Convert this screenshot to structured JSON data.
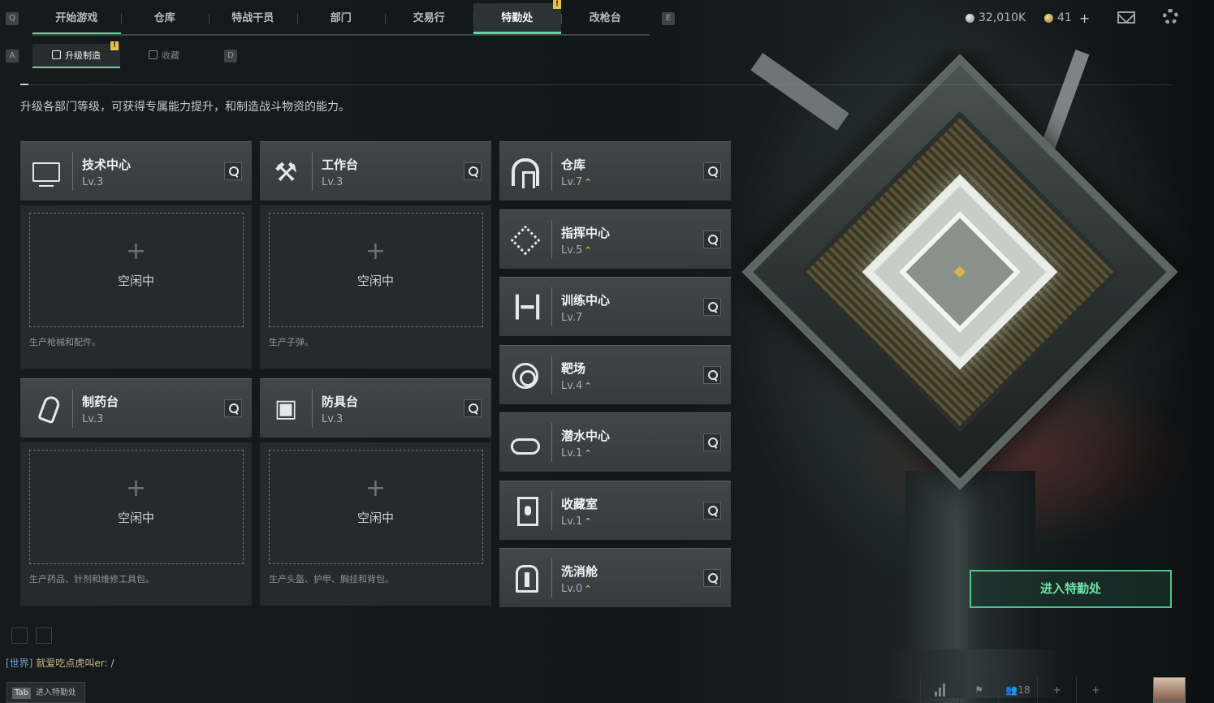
{
  "top_nav": {
    "key_left": "Q",
    "key_right": "E",
    "tabs": [
      {
        "label": "开始游戏",
        "state": "first"
      },
      {
        "label": "仓库"
      },
      {
        "label": "特战干员"
      },
      {
        "label": "部门"
      },
      {
        "label": "交易行"
      },
      {
        "label": "特勤处",
        "state": "active",
        "badge": "!"
      },
      {
        "label": "改枪台"
      }
    ]
  },
  "currency": {
    "silver": "32,010K",
    "gold": "41",
    "gold_add": "+"
  },
  "sub_nav": {
    "key_left": "A",
    "key_right": "D",
    "tabs": [
      {
        "label": "升级制造",
        "state": "active",
        "badge": "!"
      },
      {
        "label": "收藏"
      }
    ]
  },
  "description": "升级各部门等级，可获得专属能力提升，和制造战斗物资的能力。",
  "workstations": [
    {
      "title": "技术中心",
      "level": "Lv.3",
      "icon": "monitor-icon",
      "idle": "空闲中",
      "note": "生产枪械和配件。"
    },
    {
      "title": "工作台",
      "level": "Lv.3",
      "icon": "tools-icon",
      "idle": "空闲中",
      "note": "生产子弹。"
    },
    {
      "title": "制药台",
      "level": "Lv.3",
      "icon": "microscope-icon",
      "idle": "空闲中",
      "note": "生产药品、针剂和维修工具包。"
    },
    {
      "title": "防具台",
      "level": "Lv.3",
      "icon": "blocks-icon",
      "idle": "空闲中",
      "note": "生产头盔、护甲、胸挂和背包。"
    }
  ],
  "facilities": [
    {
      "title": "仓库",
      "level": "Lv.7",
      "upgrade": "⌃",
      "icon": "warehouse-icon"
    },
    {
      "title": "指挥中心",
      "level": "Lv.5",
      "upgrade": "⌃",
      "icon": "command-icon"
    },
    {
      "title": "训练中心",
      "level": "Lv.7",
      "upgrade": "",
      "icon": "dumbbell-icon"
    },
    {
      "title": "靶场",
      "level": "Lv.4",
      "upgrade": "⌃",
      "icon": "target-icon"
    },
    {
      "title": "潜水中心",
      "level": "Lv.1",
      "upgrade": "⌃",
      "icon": "diving-mask-icon"
    },
    {
      "title": "收藏室",
      "level": "Lv.1",
      "upgrade": "⌃",
      "icon": "cabinet-icon"
    },
    {
      "title": "洗消舱",
      "level": "Lv.0",
      "upgrade": "⌃",
      "icon": "pod-icon"
    }
  ],
  "enter_button": "进入特勤处",
  "chat": {
    "channel": "[世界]",
    "player": "就爱吃点虎叫er:",
    "cursor": "/"
  },
  "tab_hint": {
    "key": "Tab",
    "label": "进入特勤处"
  },
  "bottom_bar": {
    "friends_count": "18"
  },
  "colors": {
    "accent": "#5fd9a3",
    "badge": "#e6c24a",
    "upgrade": "#e6c24a"
  }
}
